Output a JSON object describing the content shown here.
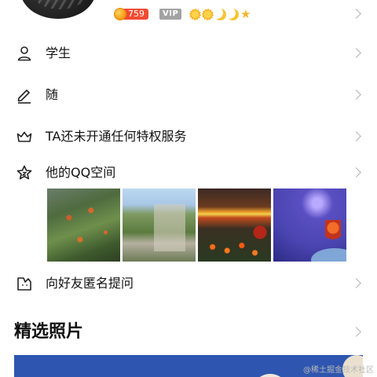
{
  "profile": {
    "coin_count": "759",
    "vip_label": "VIP",
    "level_icons": [
      "sun-icon",
      "sun-icon",
      "moon-icon",
      "moon-icon",
      "star-icon"
    ]
  },
  "rows": [
    {
      "label": "学生",
      "icon": "person-icon"
    },
    {
      "label": "随",
      "icon": "pencil-icon"
    },
    {
      "label": "TA还未开通任何特权服务",
      "icon": "crown-icon"
    },
    {
      "label": "他的QQ空间",
      "icon": "star-outline-icon"
    },
    {
      "label": "向好友匿名提问",
      "icon": "question-box-icon"
    }
  ],
  "section": {
    "title": "精选照片"
  },
  "watermark": "@稀土掘金技术社区",
  "colors": {
    "coin_badge": "#f24a32",
    "vip_badge": "#a3a3a3",
    "banner": "#2e56b0",
    "chevron": "#b3b3b3"
  }
}
